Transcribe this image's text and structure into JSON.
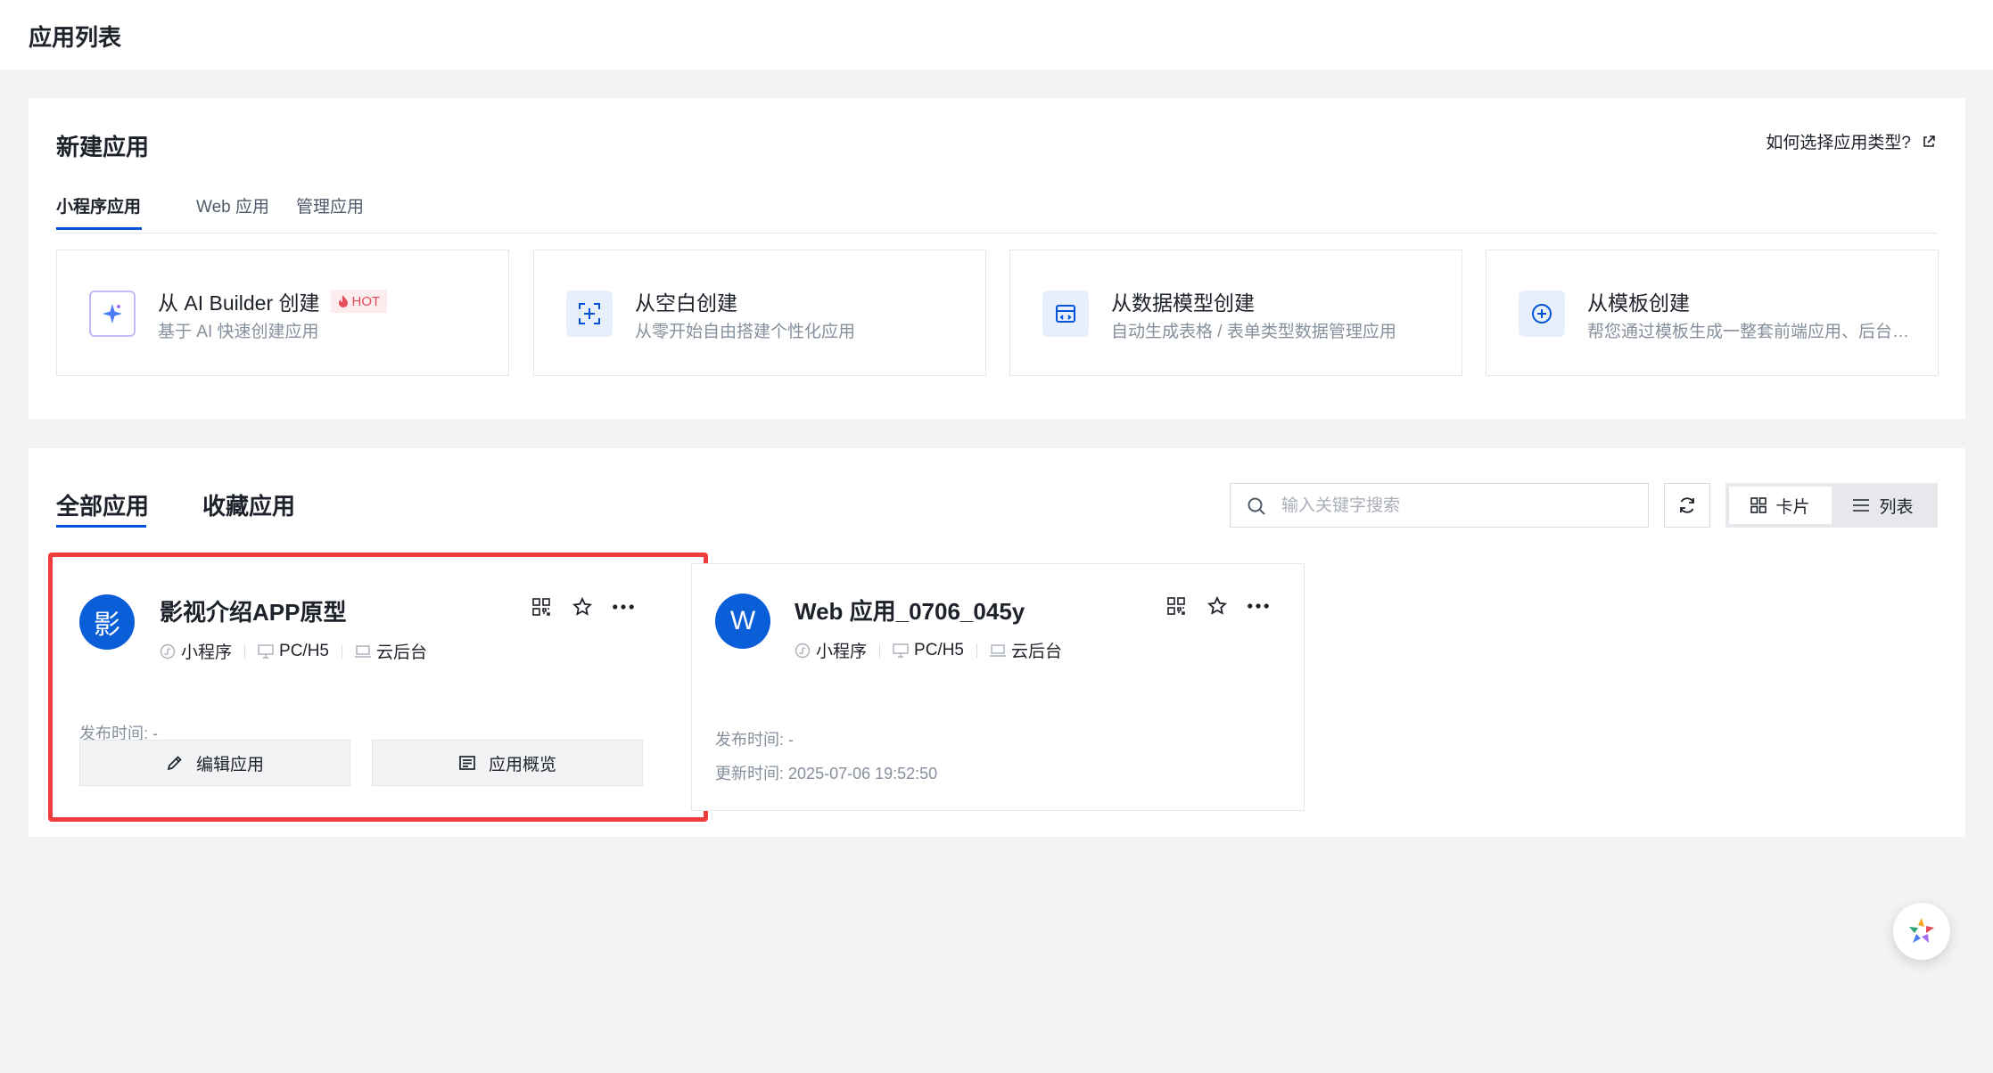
{
  "page": {
    "title": "应用列表"
  },
  "new_app": {
    "title": "新建应用",
    "help_link": "如何选择应用类型?",
    "tabs": [
      {
        "label": "小程序应用",
        "active": true
      },
      {
        "label": "Web 应用",
        "active": false
      },
      {
        "label": "管理应用",
        "active": false
      }
    ],
    "create_options": [
      {
        "title": "从 AI Builder 创建",
        "badge": "HOT",
        "desc": "基于 AI 快速创建应用",
        "icon": "ai-sparkle-icon"
      },
      {
        "title": "从空白创建",
        "desc": "从零开始自由搭建个性化应用",
        "icon": "blank-add-icon"
      },
      {
        "title": "从数据模型创建",
        "desc": "自动生成表格 / 表单类型数据管理应用",
        "icon": "data-model-icon"
      },
      {
        "title": "从模板创建",
        "desc": "帮您通过模板生成一整套前端应用、后台管理应用",
        "icon": "template-add-icon"
      }
    ]
  },
  "app_list": {
    "tabs": [
      {
        "label": "全部应用",
        "active": true
      },
      {
        "label": "收藏应用",
        "active": false
      }
    ],
    "search": {
      "placeholder": "输入关键字搜索",
      "value": ""
    },
    "view": {
      "card_label": "卡片",
      "list_label": "列表",
      "selected": "卡片"
    },
    "apps": [
      {
        "avatar": "影",
        "name": "影视介绍APP原型",
        "platforms": [
          "小程序",
          "PC/H5",
          "云后台"
        ],
        "publish_label": "发布时间:",
        "publish_value": "-",
        "edit_label": "编辑应用",
        "overview_label": "应用概览",
        "highlighted": true
      },
      {
        "avatar": "W",
        "name": "Web 应用_0706_045y",
        "platforms": [
          "小程序",
          "PC/H5",
          "云后台"
        ],
        "publish_label": "发布时间:",
        "publish_value": "-",
        "update_label": "更新时间:",
        "update_value": "2025-07-06 19:52:50",
        "highlighted": false
      }
    ]
  },
  "colors": {
    "brand": "#0052d9",
    "highlight_border": "#ef3b3b",
    "hot": "#e34d59"
  }
}
